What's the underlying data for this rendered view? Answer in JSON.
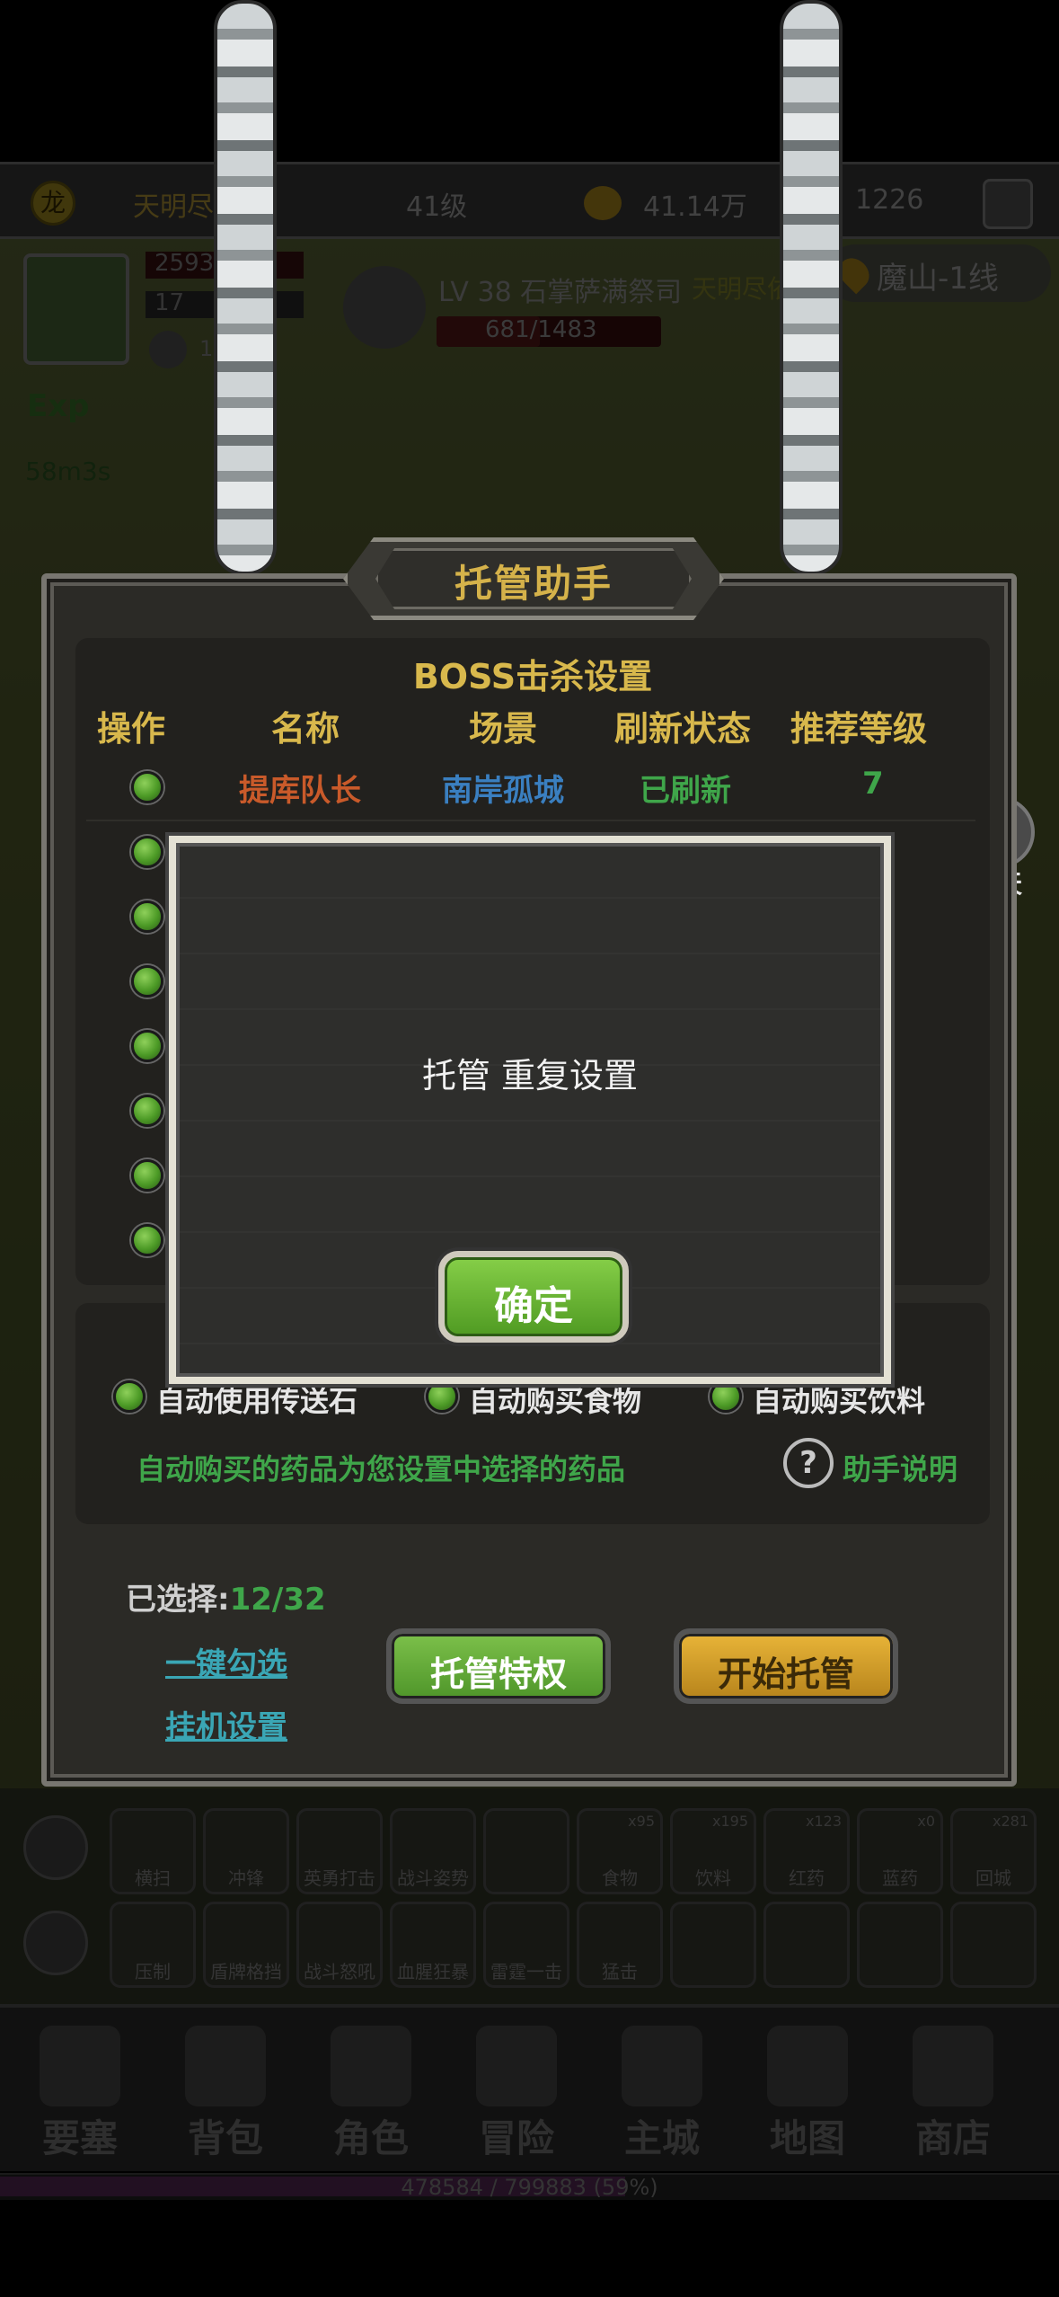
{
  "status_bar": {
    "player_name": "天明尽",
    "level": "41级",
    "gold": "41.14万",
    "gems": "1226",
    "logo_text": "龙"
  },
  "player": {
    "hp_value": "2593",
    "mp_value": "17",
    "mini_count": "1"
  },
  "boss_target": {
    "title": "LV 38 石掌萨满祭司",
    "guild": "天明尽依",
    "hp": "681/1483",
    "hp_fraction": 0.46
  },
  "location": "魔山-1线",
  "exp": {
    "label": "Exp",
    "rate": "58m3s"
  },
  "chat": {
    "label": "聊天"
  },
  "panel": {
    "title": "托管助手",
    "boss_settings_title": "BOSS击杀设置",
    "columns": [
      "操作",
      "名称",
      "场景",
      "刷新状态",
      "推荐等级"
    ],
    "rows": [
      {
        "name": "提库队长",
        "scene": "南岸孤城",
        "status": "已刷新",
        "level": "7"
      }
    ],
    "options": [
      {
        "label": "自动使用传送石"
      },
      {
        "label": "自动购买食物"
      },
      {
        "label": "自动购买饮料"
      }
    ],
    "note": "自动购买的药品为您设置中选择的药品",
    "help_label": "助手说明",
    "selected_label": "已选择:",
    "selected_value": "12/32",
    "links": [
      "一键勾选",
      "挂机设置"
    ],
    "btn_privilege": "托管特权",
    "btn_start": "开始托管"
  },
  "modal": {
    "message": "托管 重复设置",
    "ok_label": "确定"
  },
  "skills_row1": [
    "横扫",
    "冲锋",
    "英勇打击",
    "战斗姿势",
    "",
    "食物",
    "饮料",
    "红药",
    "蓝药",
    "回城"
  ],
  "skills_row1_counts": [
    "",
    "",
    "",
    "",
    "",
    "x95",
    "x195",
    "x123",
    "x0",
    "x281"
  ],
  "skills_row2": [
    "压制",
    "盾牌格挡",
    "战斗怒吼",
    "血腥狂暴",
    "雷霆一击",
    "猛击"
  ],
  "nav": [
    "要塞",
    "背包",
    "角色",
    "冒险",
    "主城",
    "地图",
    "商店"
  ],
  "xp": {
    "text": "478584 / 799883 (59%)",
    "fraction": 0.59
  },
  "colors": {
    "gold_title": "#d8b84c",
    "name_orange": "#c95a2a",
    "scene_blue": "#3a7fc0",
    "status_green": "#3fa64a",
    "level_green": "#3fa64a"
  }
}
